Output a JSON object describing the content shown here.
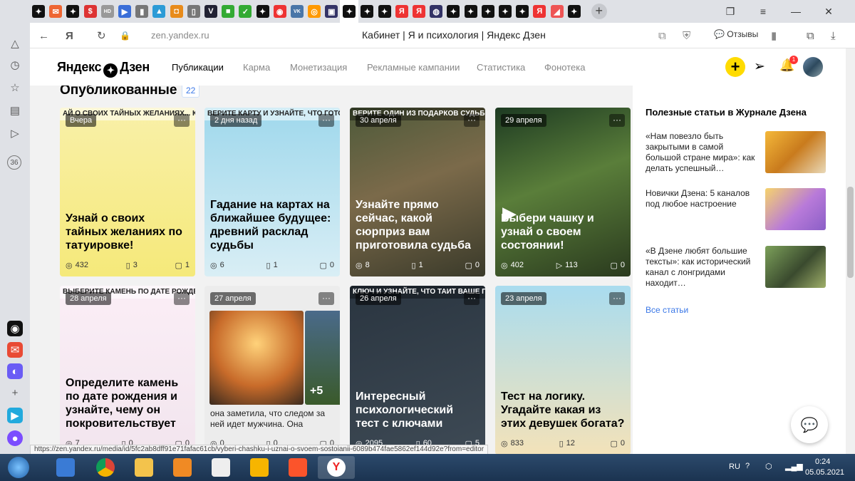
{
  "browser": {
    "tabs": [
      {
        "icon": "dzen-icon",
        "color": "#111",
        "label": "✦"
      },
      {
        "icon": "mail-icon",
        "color": "#e63",
        "label": "✉"
      },
      {
        "icon": "dzen-icon",
        "color": "#111",
        "label": "✦"
      },
      {
        "icon": "ruble-icon",
        "color": "#d33",
        "label": "$"
      },
      {
        "icon": "hd-icon",
        "color": "#999",
        "label": "HD"
      },
      {
        "icon": "play-icon",
        "color": "#3a6ed8",
        "label": "▶"
      },
      {
        "icon": "doc-icon",
        "color": "#777",
        "label": "▮"
      },
      {
        "icon": "triangle-icon",
        "color": "#2c9bd6",
        "label": "▲"
      },
      {
        "icon": "box-icon",
        "color": "#e88b1a",
        "label": "◘"
      },
      {
        "icon": "page-icon",
        "color": "#777",
        "label": "▯"
      },
      {
        "icon": "v-icon",
        "color": "#223",
        "label": "V"
      },
      {
        "icon": "shop-icon",
        "color": "#3a3",
        "label": "■"
      },
      {
        "icon": "check-icon",
        "color": "#3a3",
        "label": "✓"
      },
      {
        "icon": "dzen-icon",
        "color": "#111",
        "label": "✦"
      },
      {
        "icon": "toggle-icon",
        "color": "#e33",
        "label": "◉"
      },
      {
        "icon": "vk-icon",
        "color": "#4a76a8",
        "label": "VK"
      },
      {
        "icon": "ok-icon",
        "color": "#f90",
        "label": "◎"
      },
      {
        "icon": "photo-icon",
        "color": "#336",
        "label": "▣"
      },
      {
        "icon": "dzen-icon",
        "color": "#111",
        "label": "✦"
      },
      {
        "icon": "dzen-icon",
        "color": "#111",
        "label": "✦"
      },
      {
        "icon": "dzen-icon",
        "color": "#111",
        "label": "✦"
      },
      {
        "icon": "yandex-icon",
        "color": "#e33",
        "label": "Я"
      },
      {
        "icon": "yandex-icon",
        "color": "#e33",
        "label": "Я"
      },
      {
        "icon": "chat-icon",
        "color": "#336",
        "label": "◍"
      },
      {
        "icon": "dzen-icon",
        "color": "#111",
        "label": "✦"
      },
      {
        "icon": "dzen-icon",
        "color": "#111",
        "label": "✦"
      },
      {
        "icon": "dzen-icon",
        "color": "#111",
        "label": "✦"
      },
      {
        "icon": "dzen-icon",
        "color": "#111",
        "label": "✦"
      },
      {
        "icon": "dzen-icon",
        "color": "#111",
        "label": "✦"
      },
      {
        "icon": "yandex-icon",
        "color": "#e33",
        "label": "Я"
      },
      {
        "icon": "flag-icon",
        "color": "#e55",
        "label": "◢"
      },
      {
        "icon": "dzen-icon",
        "color": "#111",
        "label": "✦"
      }
    ],
    "url": "zen.yandex.ru",
    "page_title": "Кабинет | Я и психология | Яндекс Дзен",
    "feedback_label": "Отзывы",
    "left_panel_badge": "36",
    "status_url": "https://zen.yandex.ru/media/id/5fc2ab8dff91e71fafac61cb/vyberi-chashku-i-uznai-o-svoem-sostoianii-6089b474fae5862ef144d92e?from=editor"
  },
  "zen": {
    "logo": "Яндекс Дзен",
    "nav": [
      "Публикации",
      "Карма",
      "Монетизация",
      "Рекламные кампании",
      "Статистика",
      "Фонотека"
    ],
    "notif_count": "1"
  },
  "published": {
    "title": "Опубликованные",
    "count": "22",
    "cards": [
      {
        "date": "Вчера",
        "banner": "АЙ О СВОИХ ТАЙНЫХ ЖЕЛАНИЯХ... КАЯ ТАТУИРОВКА ВАМ НРАВИТСЯ",
        "title": "Узнай о своих тайных желаниях по татуировке!",
        "views": "432",
        "reads": "3",
        "comments": "1",
        "icon2": "book",
        "dark": false
      },
      {
        "date": "2 дня назад",
        "banner": "ВЕРИТЕ КАРТУ И УЗНАЙТЕ, ЧТО ГОТОВИТ СУДЬБА",
        "title": "Гадание на картах на ближайшее будущее: древний расклад судьбы",
        "views": "6",
        "reads": "1",
        "comments": "0",
        "icon2": "book",
        "dark": false
      },
      {
        "date": "30 апреля",
        "banner": "ВЕРИТЕ ОДИН ИЗ ПОДАРКОВ СУДЬБЫ",
        "title": "Узнайте прямо сейчас, какой сюрприз вам приготовила судьба",
        "views": "8",
        "reads": "1",
        "comments": "0",
        "icon2": "book",
        "dark": true
      },
      {
        "date": "29 апреля",
        "banner": "",
        "title": "Выбери чашку и узнай о своем состоянии!",
        "views": "402",
        "reads": "113",
        "comments": "0",
        "icon2": "play",
        "dark": true
      },
      {
        "date": "28 апреля",
        "banner": "ВЫБЕРИТЕ КАМЕНЬ ПО ДАТЕ РОЖДЕНИЯ",
        "title": "Определите камень по дате рождения и узнайте, чему он покровительствует",
        "views": "7",
        "reads": "0",
        "comments": "0",
        "icon2": "book",
        "dark": false
      },
      {
        "date": "27 апреля",
        "banner": "",
        "title": "",
        "text": "она заметила, что следом за ней идет мужчина. Она",
        "more_photos": "+5",
        "views": "0",
        "reads": "0",
        "comments": "0",
        "icon2": "book",
        "dark": false
      },
      {
        "date": "26 апреля",
        "banner": "КЛЮЧ И УЗНАЙТЕ, ЧТО ТАИТ ВАШЕ ПОДСОЗНАНИЕ",
        "title": "Интересный психологический тест с ключами",
        "views": "2095",
        "reads": "60",
        "comments": "5",
        "icon2": "book",
        "dark": true
      },
      {
        "date": "23 апреля",
        "banner": "",
        "title": "Тест на логику. Угадайте какая из этих девушек богата?",
        "views": "833",
        "reads": "12",
        "comments": "0",
        "icon2": "book",
        "dark": false
      }
    ]
  },
  "sidebar": {
    "title": "Полезные статьи в Журнале Дзена",
    "items": [
      {
        "text": "«Нам повезло быть закрытыми в самой большой стране мира»: как делать успешный…"
      },
      {
        "text": "Новички Дзена: 5 каналов под любое настроение"
      },
      {
        "text": "«В Дзене любят большие тексты»: как исторический канал с лонгридами находит…"
      }
    ],
    "all_link": "Все статьи"
  },
  "taskbar": {
    "lang": "RU",
    "time": "0:24",
    "date": "05.05.2021"
  }
}
